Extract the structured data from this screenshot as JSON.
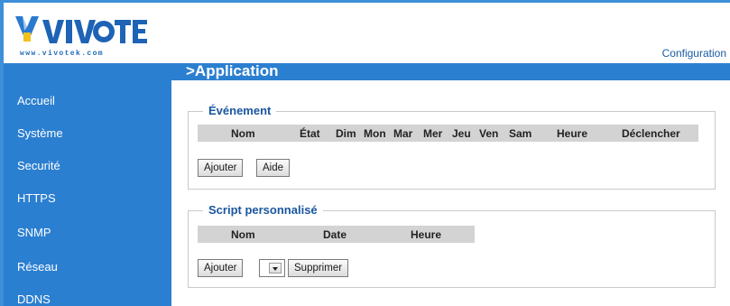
{
  "brand": {
    "name": "VIVOTEK",
    "tagline": "www.vivotek.com"
  },
  "header": {
    "config_link": "Configuration",
    "page_title": ">Application"
  },
  "sidebar": {
    "items": [
      {
        "label": "Accueil"
      },
      {
        "label": "Système"
      },
      {
        "label": "Securité"
      },
      {
        "label": "HTTPS"
      },
      {
        "label": "SNMP"
      },
      {
        "label": "Réseau"
      },
      {
        "label": "DDNS"
      }
    ]
  },
  "event_section": {
    "legend": "Événement",
    "columns": [
      "Nom",
      "État",
      "Dim",
      "Mon",
      "Mar",
      "Mer",
      "Jeu",
      "Ven",
      "Sam",
      "Heure",
      "Déclencher"
    ],
    "add_button": "Ajouter",
    "help_button": "Aide"
  },
  "script_section": {
    "legend": "Script personnalisé",
    "columns": [
      "Nom",
      "Date",
      "Heure"
    ],
    "add_button": "Ajouter",
    "delete_button": "Supprimer",
    "selected_value": ""
  },
  "colors": {
    "accent": "#2b7fd0",
    "legend_text": "#1a56a0",
    "table_header": "#d3d3d3"
  }
}
